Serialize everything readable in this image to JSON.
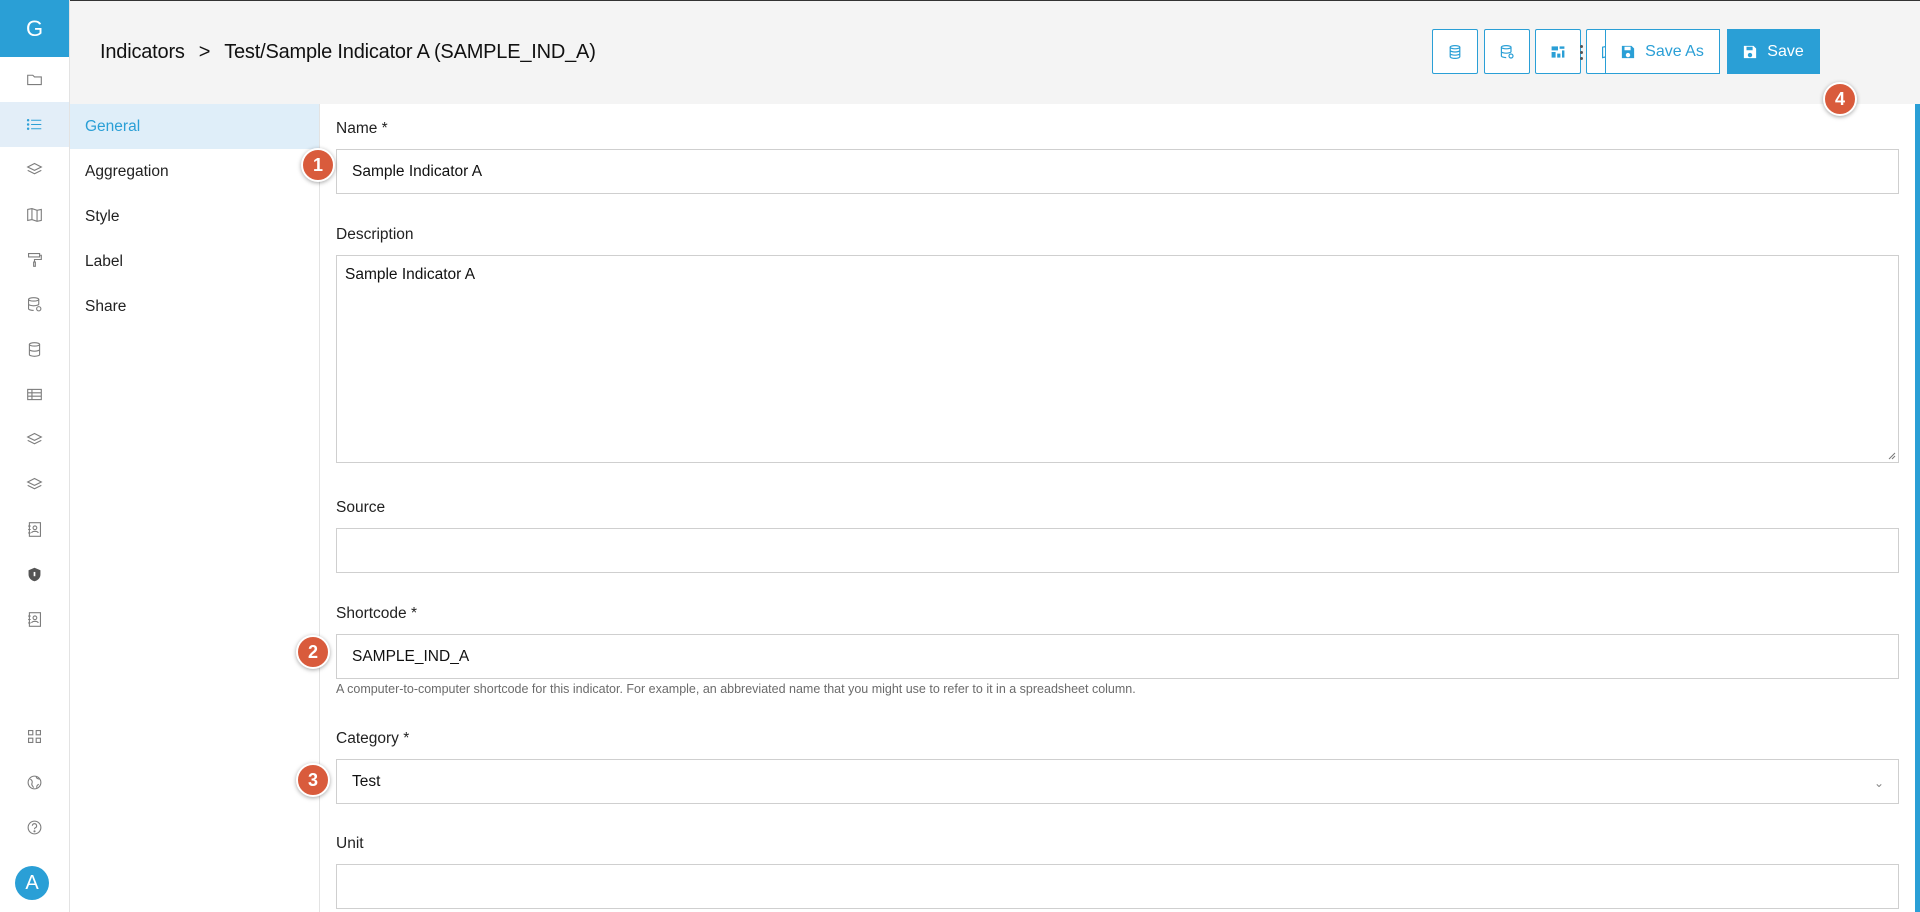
{
  "app": {
    "logo_letter": "G",
    "avatar_letter": "A"
  },
  "breadcrumb": {
    "section": "Indicators",
    "separator": ">",
    "current": "Test/Sample Indicator A (SAMPLE_IND_A)"
  },
  "toolbar": {
    "save_as_label": "Save As",
    "save_label": "Save"
  },
  "rail_icons": [
    "folder-icon",
    "list-icon",
    "layers-icon",
    "map-icon",
    "paint-roller-icon",
    "database-settings-icon",
    "database-icon",
    "table-icon",
    "layers-icon",
    "layers-icon",
    "contact-book-icon",
    "shield-icon",
    "contact-book-icon",
    "grid-icon",
    "globe-icon",
    "help-icon"
  ],
  "sections": [
    {
      "label": "General",
      "active": true
    },
    {
      "label": "Aggregation",
      "active": false
    },
    {
      "label": "Style",
      "active": false
    },
    {
      "label": "Label",
      "active": false
    },
    {
      "label": "Share",
      "active": false
    }
  ],
  "form": {
    "name": {
      "label": "Name *",
      "value": "Sample Indicator A"
    },
    "description": {
      "label": "Description",
      "value": "Sample Indicator A"
    },
    "source": {
      "label": "Source",
      "value": ""
    },
    "shortcode": {
      "label": "Shortcode *",
      "value": "SAMPLE_IND_A",
      "help": "A computer-to-computer shortcode for this indicator. For example, an abbreviated name that you might use to refer to it in a spreadsheet column."
    },
    "category": {
      "label": "Category *",
      "value": "Test"
    },
    "unit": {
      "label": "Unit",
      "value": ""
    }
  },
  "badges": [
    "1",
    "2",
    "3",
    "4"
  ],
  "colors": {
    "accent": "#2a9fd6",
    "badge": "#d95b3c"
  }
}
